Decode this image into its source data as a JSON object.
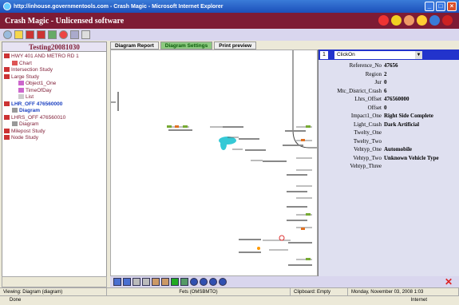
{
  "window": {
    "title": "http://inhouse.governmentools.com - Crash Magic - Microsoft Internet Explorer",
    "minimize": "_",
    "maximize": "□",
    "close": "×"
  },
  "app": {
    "title": "Crash Magic - Unlicensed software"
  },
  "left_pane": {
    "header": "Testing20081030",
    "tree": [
      {
        "label": "HWY 401 AND METRO RD 1",
        "level": 0
      },
      {
        "label": "Chart",
        "level": 1
      },
      {
        "label": "Intersection Study",
        "level": 0
      },
      {
        "label": "Large Study",
        "level": 0
      },
      {
        "label": "Object1_One",
        "level": 1
      },
      {
        "label": "TimeOfDay",
        "level": 1
      },
      {
        "label": "List",
        "level": 1
      },
      {
        "label": "LHR_OFF 476560000",
        "level": 0,
        "selected": true
      },
      {
        "label": "Diagram",
        "level": 1,
        "selected": true
      },
      {
        "label": "LHRS_OFF 476560010",
        "level": 0
      },
      {
        "label": "Diagram",
        "level": 1
      },
      {
        "label": "Milepost Study",
        "level": 0
      },
      {
        "label": "Node Study",
        "level": 0
      }
    ]
  },
  "tabs": [
    {
      "label": "Diagram Report",
      "active": false
    },
    {
      "label": "Diagram Settings",
      "active": true
    },
    {
      "label": "Print preview",
      "active": false
    }
  ],
  "right_pane": {
    "number": "1",
    "select_value": "ClickOn",
    "props": [
      {
        "key": "Reference_No",
        "value": "47656"
      },
      {
        "key": "Region",
        "value": "2"
      },
      {
        "key": "Jur",
        "value": "0"
      },
      {
        "key": "Mtc_District_Crash",
        "value": "6"
      },
      {
        "key": "Lhrs_Offset",
        "value": "476560000"
      },
      {
        "key": "Offset",
        "value": "0"
      },
      {
        "key": "Impact1_One",
        "value": "Right Side Complete"
      },
      {
        "key": "Light_Crash",
        "value": "Dark Artificial"
      },
      {
        "key": "Twelty_One",
        "value": ""
      },
      {
        "key": "Twelty_Two",
        "value": ""
      },
      {
        "key": "Vehtyp_One",
        "value": "Automobile"
      },
      {
        "key": "Vehtyp_Two",
        "value": "Unknown Vehicle Type"
      },
      {
        "key": "Vehtyp_Three",
        "value": ""
      }
    ]
  },
  "status": {
    "left": "Viewing: Diagram (diagram)",
    "fets": "Fets (OMSBMTO)",
    "clipboard": "Clipboard: Empty",
    "datetime": "Monday, November 03, 2008 1:03"
  },
  "ie_status": {
    "done": "Done",
    "zone": "Internet"
  },
  "colors": {
    "app_bar": "#7e1b34",
    "selected_tab": "#8cc97f",
    "prop_header": "#2233cc",
    "highlight": "#35c9d6"
  }
}
